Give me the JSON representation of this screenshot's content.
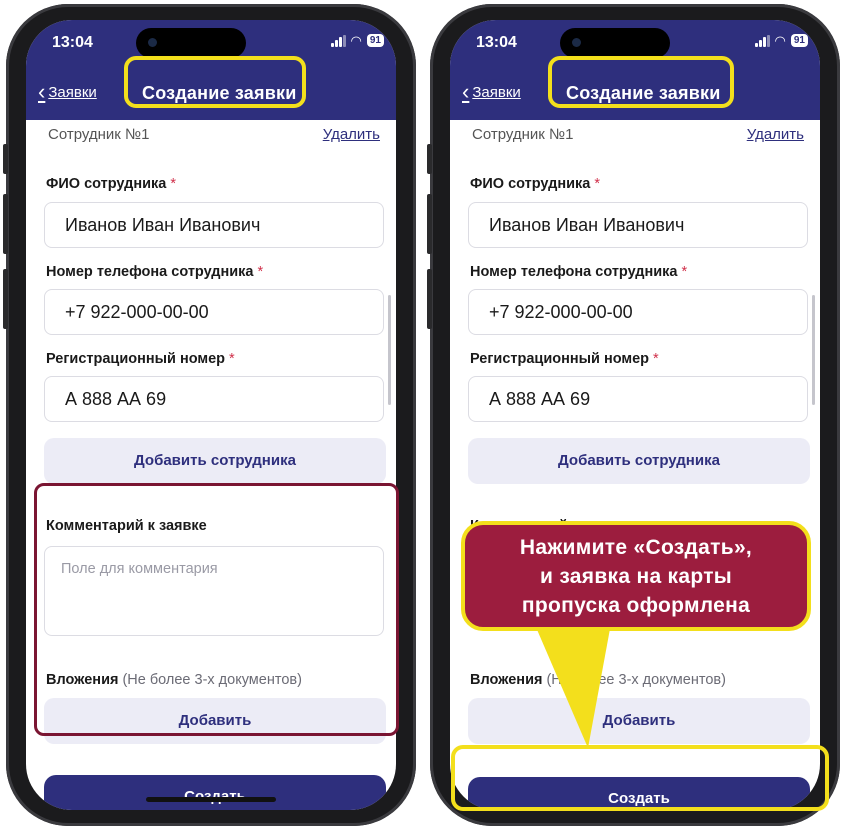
{
  "status": {
    "time": "13:04",
    "battery": "91"
  },
  "nav": {
    "back_label": "Заявки",
    "title": "Создание заявки"
  },
  "form": {
    "employee_header": "Сотрудник №1",
    "delete_label": "Удалить",
    "fio_label": "ФИО сотрудника",
    "fio_value": "Иванов Иван Иванович",
    "phone_label": "Номер телефона сотрудника",
    "phone_value": "+7 922-000-00-00",
    "reg_label": "Регистрационный номер",
    "reg_value": "А 888 АА 69",
    "required_mark": "*",
    "add_employee_label": "Добавить сотрудника",
    "comment_label": "Комментарий к заявке",
    "comment_placeholder": "Поле для комментария",
    "attachments_label": "Вложения",
    "attachments_note": "(Не более 3-х документов)",
    "add_label": "Добавить",
    "create_label": "Создать"
  },
  "callout": {
    "lines": [
      "Нажимите «Создать»,",
      "и заявка на карты",
      "пропуска оформлена"
    ]
  },
  "colors": {
    "brand": "#2e2f7d",
    "highlight": "#f3df1c",
    "callout_bg": "#9c1d3e",
    "frame": "#7a1532"
  }
}
